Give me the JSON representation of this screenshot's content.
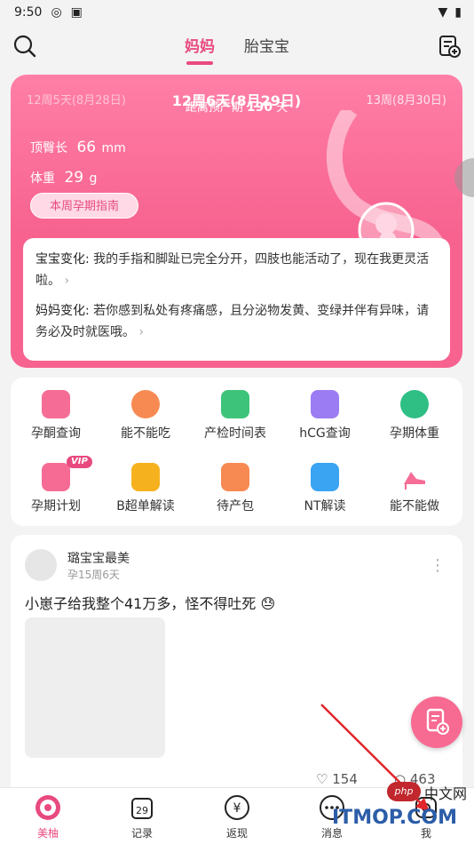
{
  "status_bar": {
    "time": "9:50",
    "icons": [
      "vpn-icon",
      "a-icon"
    ],
    "right_icons": [
      "wifi-icon",
      "battery-icon"
    ]
  },
  "header": {
    "tabs": [
      {
        "label": "妈妈",
        "active": true
      },
      {
        "label": "胎宝宝",
        "active": false
      }
    ],
    "icons": [
      "search-icon",
      "calendar-add-icon"
    ]
  },
  "week_card": {
    "prev": "12周5天(8月28日)",
    "current": "12周6天(8月29日)",
    "next": "13周(8月30日)",
    "due_prefix": "距离预产期",
    "due_days": "190",
    "due_suffix": "天",
    "crl_label": "顶臀长",
    "crl_value": "66",
    "crl_unit": "mm",
    "weight_label": "体重",
    "weight_value": "29",
    "weight_unit": "g",
    "guide_button": "本周孕期指南",
    "baby_change_label": "宝宝变化:",
    "baby_change_text": "我的手指和脚趾已完全分开，四肢也能活动了，现在我更灵活啦。",
    "mom_change_label": "妈妈变化:",
    "mom_change_text": "若你感到私处有疼痛感，且分泌物发黄、变绿并伴有异味，请务必及时就医哦。",
    "arrow": "›"
  },
  "tools": [
    {
      "label": "孕酮查询",
      "icon": "progesterone-icon",
      "color": "#f56d96"
    },
    {
      "label": "能不能吃",
      "icon": "crab-icon",
      "color": "#f78a52"
    },
    {
      "label": "产检时间表",
      "icon": "checkup-schedule-icon",
      "color": "#3ec47a"
    },
    {
      "label": "hCG查询",
      "icon": "hcg-icon",
      "color": "#9b7cf2"
    },
    {
      "label": "孕期体重",
      "icon": "scale-icon",
      "color": "#2fbe84"
    },
    {
      "label": "孕期计划",
      "icon": "pregnancy-plan-icon",
      "color": "#f66b93",
      "badge": "VIP"
    },
    {
      "label": "B超单解读",
      "icon": "ultrasound-icon",
      "color": "#f5b21e"
    },
    {
      "label": "待产包",
      "icon": "bag-icon",
      "color": "#f78a52"
    },
    {
      "label": "NT解读",
      "icon": "nt-icon",
      "color": "#3aa4f2"
    },
    {
      "label": "能不能做",
      "icon": "high-heel-icon",
      "color": "#f56d96"
    }
  ],
  "post": {
    "username": "璐宝宝最美",
    "week": "孕15周6天",
    "text": "小崽子给我整个41万多，怪不得吐死",
    "emoji": "😓",
    "more": "⋮",
    "likes": "154",
    "comments": "463"
  },
  "bottom_nav": [
    {
      "label": "美柚",
      "icon": "meiyou-icon",
      "active": true
    },
    {
      "label": "记录",
      "icon": "record-calendar-icon",
      "active": false,
      "day": "29"
    },
    {
      "label": "返现",
      "icon": "cashback-icon",
      "active": false
    },
    {
      "label": "消息",
      "icon": "message-icon",
      "active": false
    },
    {
      "label": "我",
      "icon": "profile-icon",
      "active": false
    }
  ],
  "watermark": {
    "php": "php",
    "cn": "中文网",
    "site": "ITMOP.COM"
  },
  "colors": {
    "brand_pink": "#e84a7f",
    "card_pink": "#f7628f",
    "bg": "#f3f3f3"
  }
}
